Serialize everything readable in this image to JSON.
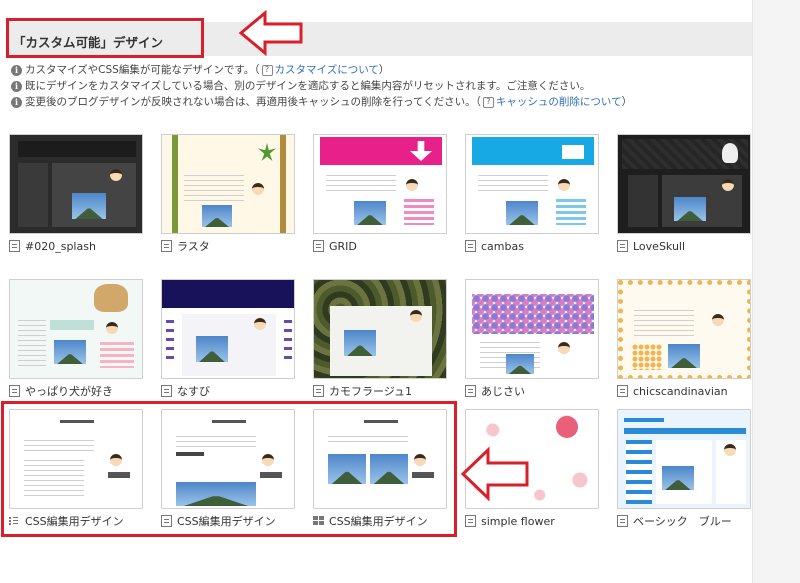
{
  "header": {
    "title": "「カスタム可能」デザイン"
  },
  "notes": {
    "line1_text": "カスタマイズやCSS編集が可能なデザインです。（",
    "line1_link": "カスタマイズについて",
    "line1_end": "）",
    "line2_text": "既にデザインをカスタマイズしている場合、別のデザインを適応すると編集内容がリセットされます。ご注意ください。",
    "line3_text": "変更後のブログデザインが反映されない場合は、再適用後キャッシュの削除を行ってください。（",
    "line3_link": "キャッシュの削除について",
    "line3_end": "）"
  },
  "designs": [
    {
      "label": "#020_splash"
    },
    {
      "label": "ラスタ"
    },
    {
      "label": "GRID"
    },
    {
      "label": "cambas"
    },
    {
      "label": "LoveSkull"
    },
    {
      "label": "やっぱり犬が好き"
    },
    {
      "label": "なすび"
    },
    {
      "label": "カモフラージュ1"
    },
    {
      "label": "あじさい"
    },
    {
      "label": "chicscandinavian"
    },
    {
      "label": "CSS編集用デザイン"
    },
    {
      "label": "CSS編集用デザイン"
    },
    {
      "label": "CSS編集用デザイン"
    },
    {
      "label": "simple flower"
    },
    {
      "label": "ベーシック　ブルー"
    }
  ],
  "colors": {
    "highlight_red": "#d9202a",
    "link_blue": "#2f6fb8",
    "header_bg": "#ececec"
  }
}
